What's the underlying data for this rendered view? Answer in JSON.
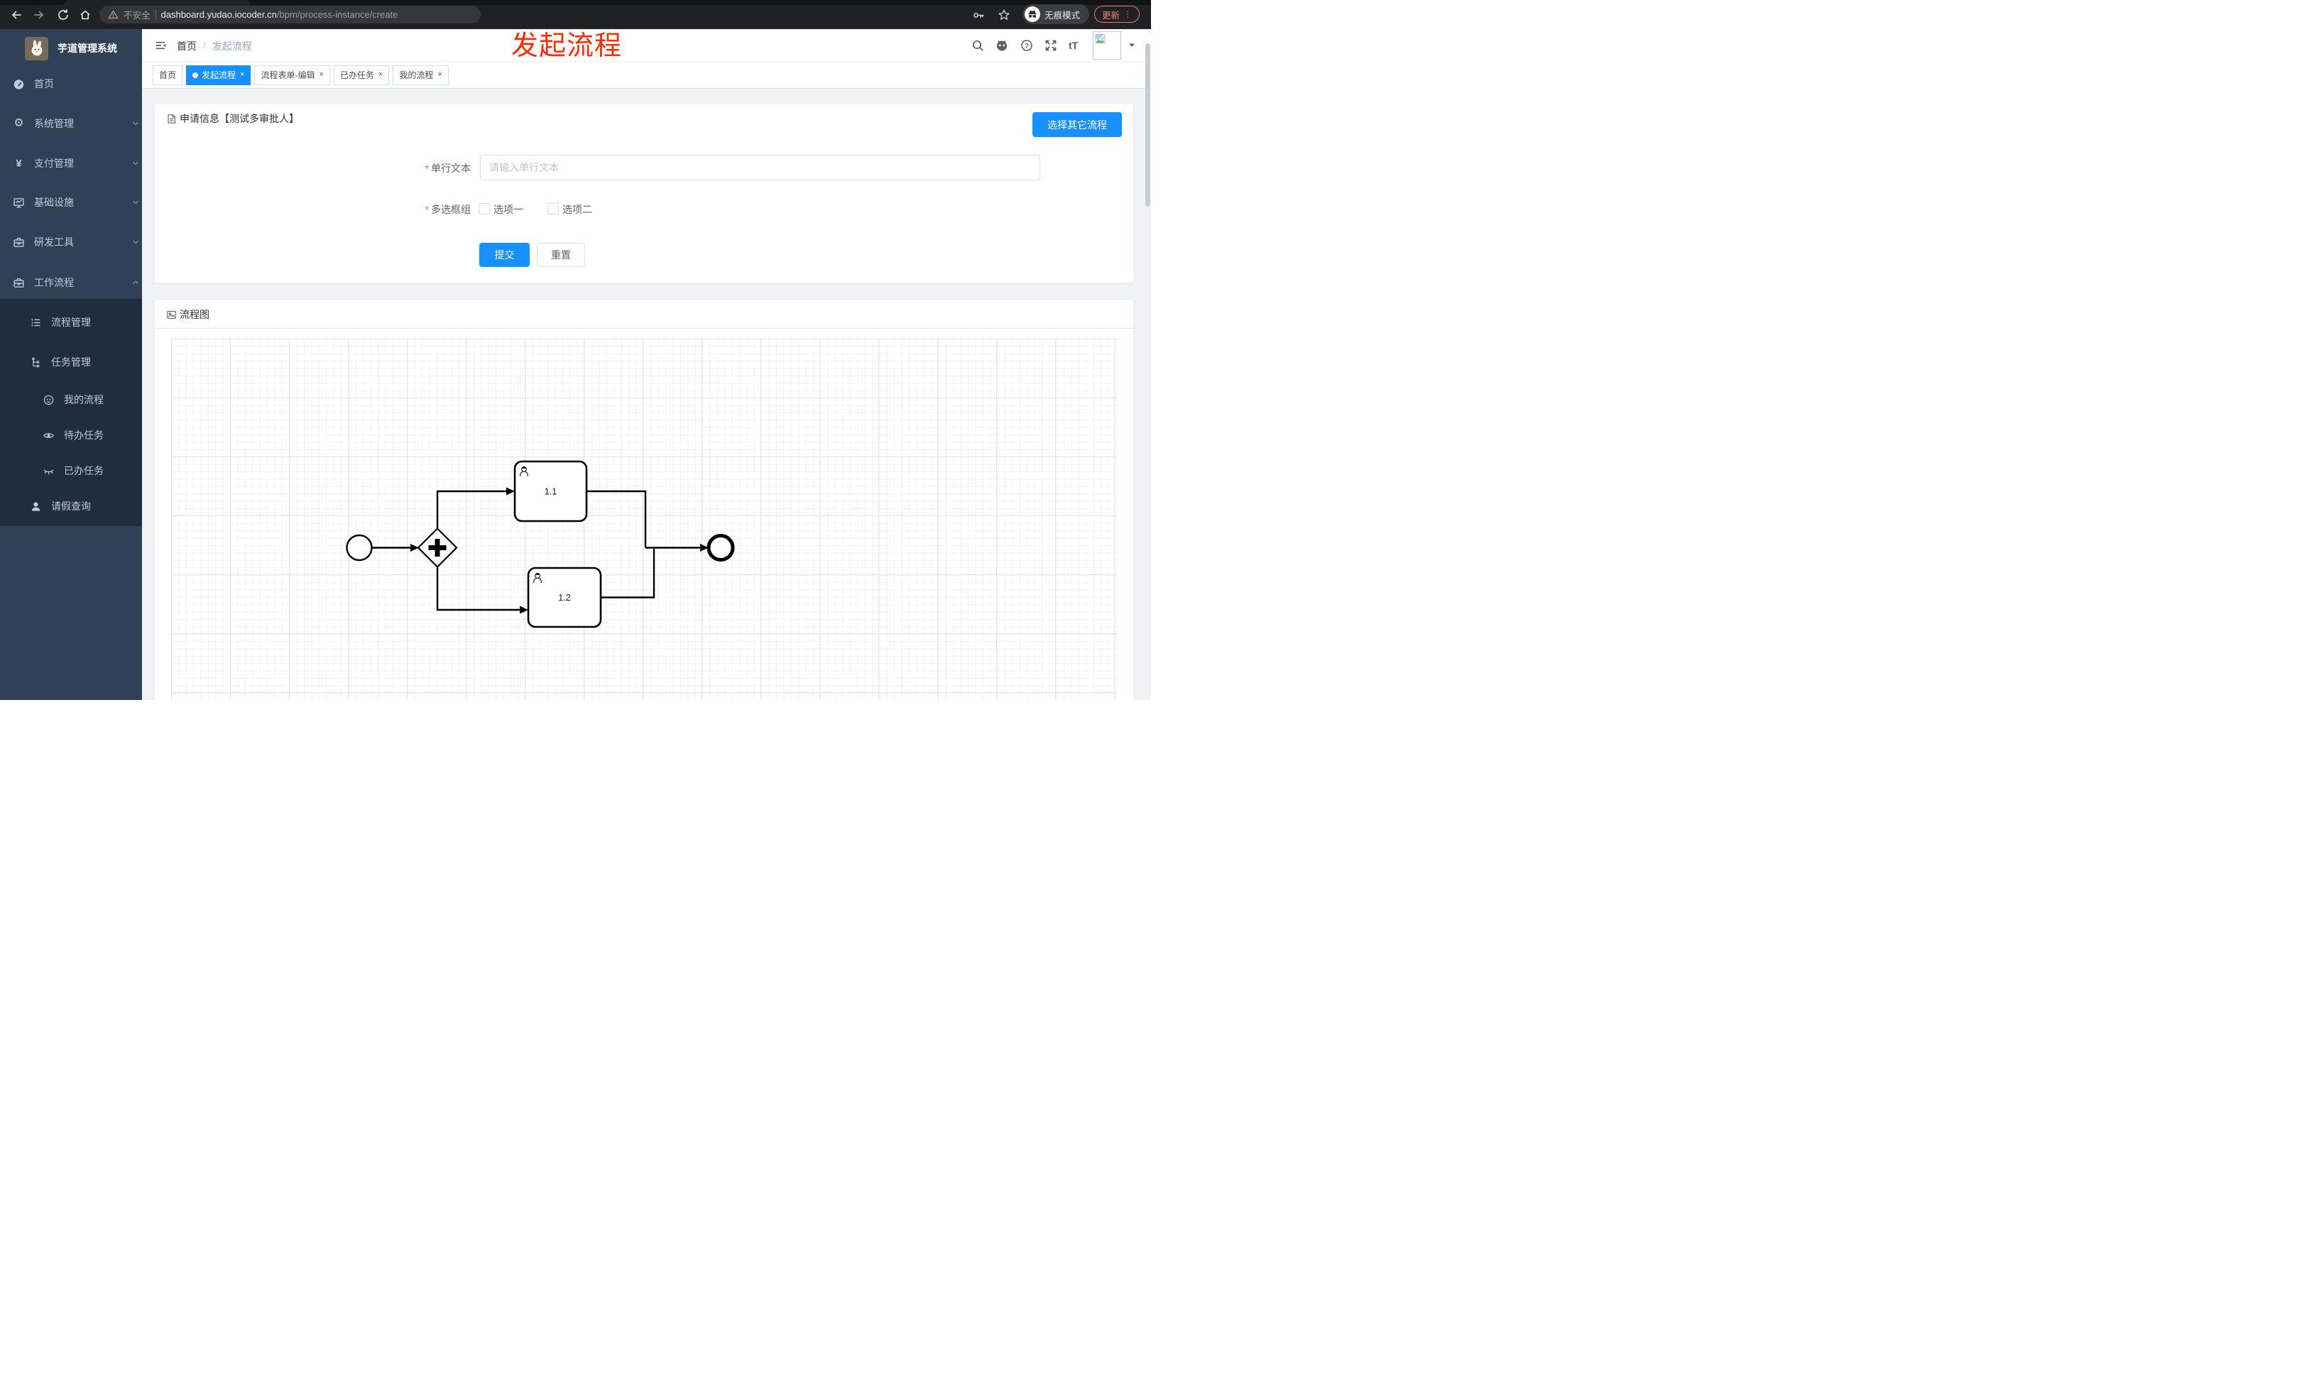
{
  "browser": {
    "security_label": "不安全",
    "url_host": "dashboard.yudao.iocoder.cn",
    "url_path": "/bpm/process-instance/create",
    "incognito_label": "无痕模式",
    "update_label": "更新"
  },
  "annotation": {
    "text": "发起流程",
    "color": "#fe2c00"
  },
  "sidebar": {
    "title": "芋道管理系统",
    "items": [
      {
        "label": "首页"
      },
      {
        "label": "系统管理"
      },
      {
        "label": "支付管理"
      },
      {
        "label": "基础设施"
      },
      {
        "label": "研发工具"
      },
      {
        "label": "工作流程"
      },
      {
        "label": "流程管理"
      },
      {
        "label": "任务管理"
      },
      {
        "label": "我的流程"
      },
      {
        "label": "待办任务"
      },
      {
        "label": "已办任务"
      },
      {
        "label": "请假查询"
      }
    ]
  },
  "header": {
    "breadcrumb": {
      "home": "首页",
      "separator": "/",
      "current": "发起流程"
    },
    "font_size_icon_label": "tT"
  },
  "tabs": [
    {
      "label": "首页",
      "closable": false,
      "active": false
    },
    {
      "label": "发起流程",
      "closable": true,
      "active": true
    },
    {
      "label": "流程表单-编辑",
      "closable": true,
      "active": false
    },
    {
      "label": "已办任务",
      "closable": true,
      "active": false
    },
    {
      "label": "我的流程",
      "closable": true,
      "active": false
    }
  ],
  "form_card": {
    "title": "申请信息【测试多审批人】",
    "select_other_button": "选择其它流程",
    "text_field": {
      "required_mark": "*",
      "label": "单行文本",
      "placeholder": "请输入单行文本",
      "value": ""
    },
    "checkbox_field": {
      "required_mark": "*",
      "label": "多选框组",
      "options": [
        {
          "label": "选项一",
          "checked": false
        },
        {
          "label": "选项二",
          "checked": false
        }
      ]
    },
    "submit_label": "提交",
    "reset_label": "重置"
  },
  "diagram_card": {
    "title": "流程图",
    "bpmn": {
      "nodes": [
        {
          "id": "startEvent",
          "type": "start-event",
          "label": ""
        },
        {
          "id": "parallelGateway",
          "type": "parallel-gateway",
          "label": ""
        },
        {
          "id": "userTask1",
          "type": "user-task",
          "label": "1.1"
        },
        {
          "id": "userTask2",
          "type": "user-task",
          "label": "1.2"
        },
        {
          "id": "endEvent",
          "type": "end-event",
          "label": ""
        }
      ],
      "flows": [
        {
          "from": "startEvent",
          "to": "parallelGateway"
        },
        {
          "from": "parallelGateway",
          "to": "userTask1"
        },
        {
          "from": "parallelGateway",
          "to": "userTask2"
        },
        {
          "from": "userTask1",
          "to": "endEvent"
        },
        {
          "from": "userTask2",
          "to": "endEvent"
        }
      ]
    }
  },
  "colors": {
    "accent": "#1890ff",
    "sidebar_bg": "#304156",
    "sidebar_submenu_bg": "#1f2d3d",
    "annotation_red": "#fe2c00",
    "update_button": "#f0837b",
    "required": "#f56c6c"
  }
}
